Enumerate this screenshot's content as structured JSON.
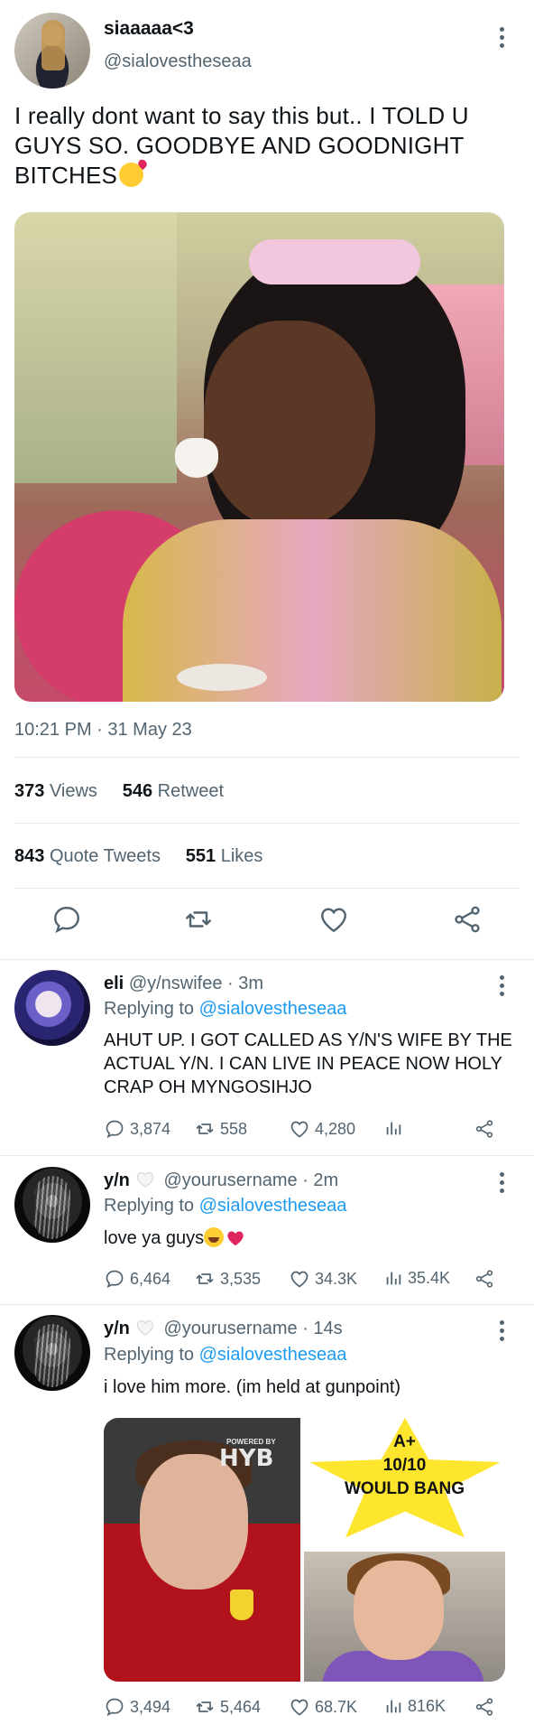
{
  "main_tweet": {
    "display_name": "siaaaaa<3",
    "handle": "@sialovestheseaa",
    "text": "I really dont want to say this but.. I TOLD U GUYS SO. GOODBYE AND GOODNIGHT BITCHES",
    "timestamp": "10:21 PM · 31 May 23",
    "views_count": "373",
    "views_label": "Views",
    "retweets_count": "546",
    "retweets_label": "Retweet",
    "quotes_count": "843",
    "quotes_label": "Quote Tweets",
    "likes_count": "551",
    "likes_label": "Likes"
  },
  "replies": [
    {
      "display_name": "eli",
      "handle": "@y/nswifee",
      "time": "· 3m",
      "replying_prefix": "Replying to",
      "replying_to": "@sialovestheseaa",
      "text": "AHUT UP. I GOT CALLED AS Y/N'S WIFE BY THE ACTUAL Y/N. I CAN LIVE IN PEACE NOW HOLY CRAP OH MYNGOSIHJO",
      "replies": "3,874",
      "retweets": "558",
      "likes": "4,280",
      "views": ""
    },
    {
      "display_name": "y/n",
      "handle": "@yourusername",
      "time": "· 2m",
      "replying_prefix": "Replying to",
      "replying_to": "@sialovestheseaa",
      "text": "love ya guys",
      "replies": "6,464",
      "retweets": "3,535",
      "likes": "34.3K",
      "views": "35.4K"
    },
    {
      "display_name": "y/n",
      "handle": "@yourusername",
      "time": "· 14s",
      "replying_prefix": "Replying to",
      "replying_to": "@sialovestheseaa",
      "text": "i love him more. (im held at gunpoint)",
      "media_text": {
        "powered_by": "POWERED BY",
        "logo": "HYB",
        "star_grade": "A+",
        "star_score": "10/10",
        "star_caption": "WOULD BANG"
      },
      "replies": "3,494",
      "retweets": "5,464",
      "likes": "68.7K",
      "views": "816K"
    }
  ],
  "colors": {
    "text": "#0f1419",
    "secondary": "#536471",
    "link": "#1d9bf0",
    "divider": "#e6ecf0"
  }
}
